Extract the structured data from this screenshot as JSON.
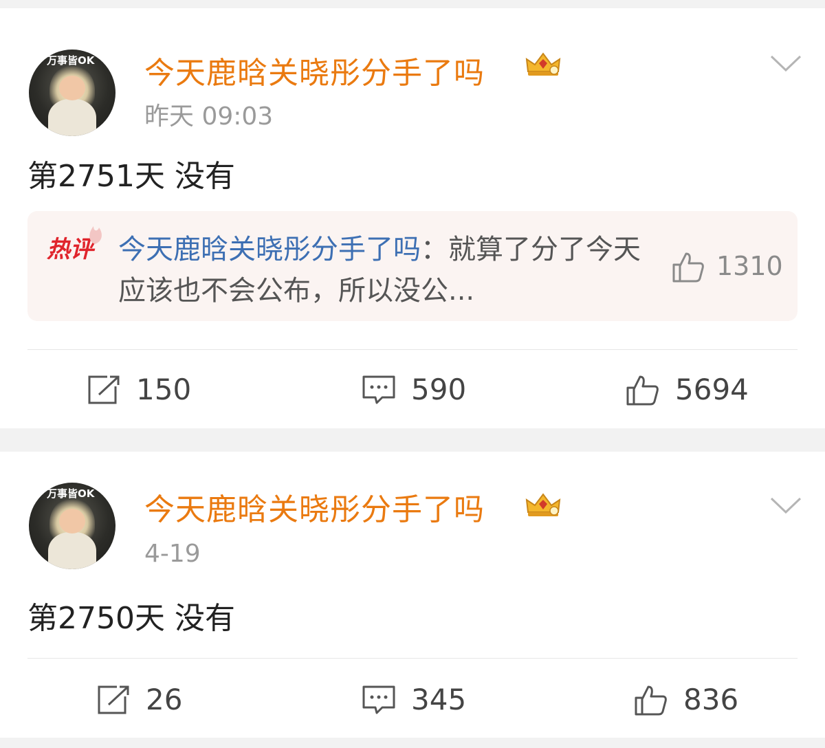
{
  "posts": [
    {
      "avatar_text": "万事皆OK",
      "username": "今天鹿晗关晓彤分手了吗",
      "badge_icon": "crown-badge-icon",
      "time": "昨天 09:03",
      "text": "第2751天 没有",
      "hot_comment": {
        "badge": "热评",
        "user": "今天鹿晗关晓彤分手了吗",
        "separator": "：",
        "text": "就算了分了今天应该也不会公布，所以没公...",
        "likes": "1310"
      },
      "actions": {
        "repost": "150",
        "comments": "590",
        "likes": "5694"
      }
    },
    {
      "avatar_text": "万事皆OK",
      "username": "今天鹿晗关晓彤分手了吗",
      "badge_icon": "crown-badge-icon",
      "time": "4-19",
      "text": "第2750天 没有",
      "actions": {
        "repost": "26",
        "comments": "345",
        "likes": "836"
      }
    }
  ],
  "colors": {
    "username": "#ea7a10",
    "hot_user": "#3d6fb3",
    "hot_badge": "#e0242c",
    "background": "#f2f2f2"
  }
}
